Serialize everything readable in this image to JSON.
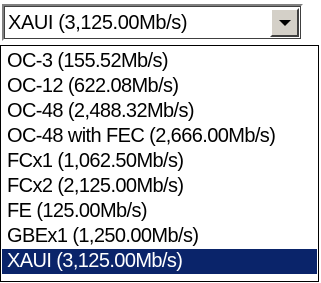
{
  "combo": {
    "value": "XAUI (3,125.00Mb/s)",
    "button_icon": "chevron-down-icon"
  },
  "options": [
    "OC-3 (155.52Mb/s)",
    "OC-12 (622.08Mb/s)",
    "OC-48 (2,488.32Mb/s)",
    "OC-48 with FEC (2,666.00Mb/s)",
    "FCx1 (1,062.50Mb/s)",
    "FCx2 (2,125.00Mb/s)",
    "FE (125.00Mb/s)",
    "GBEx1 (1,250.00Mb/s)",
    "XAUI (3,125.00Mb/s)"
  ],
  "selected_index": 8,
  "colors": {
    "selection_bg": "#0a246a",
    "selection_fg": "#ffffff",
    "button_face": "#d4d0c8"
  }
}
